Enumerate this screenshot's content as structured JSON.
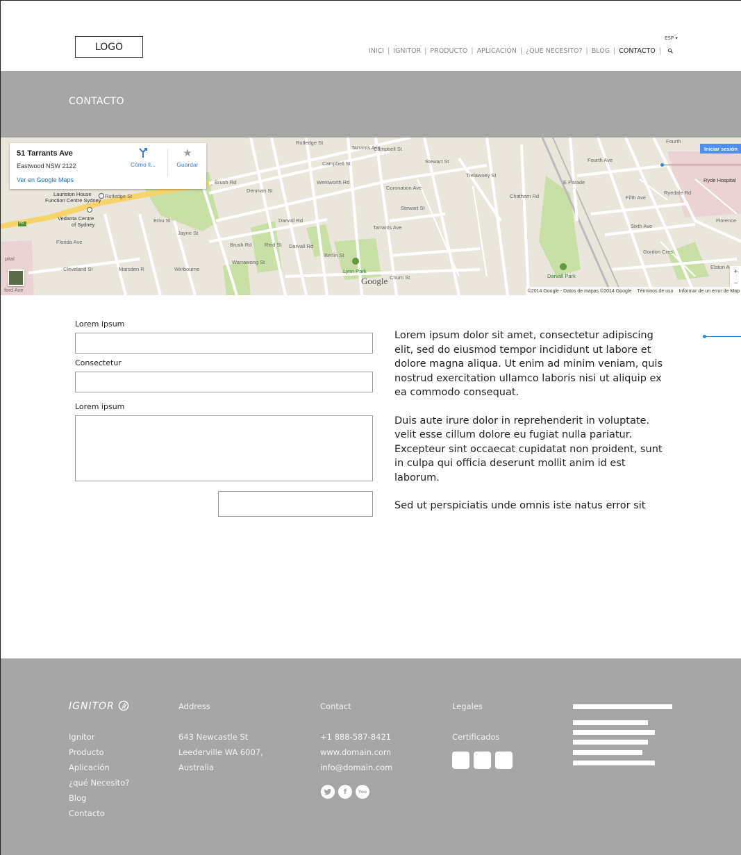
{
  "header": {
    "logo": "LOGO",
    "language": "ESP ▾",
    "nav": [
      {
        "label": "INICI",
        "active": false
      },
      {
        "label": "IGNITOR",
        "active": false
      },
      {
        "label": "PRODUCTO",
        "active": false
      },
      {
        "label": "APLICACIÓN",
        "active": false
      },
      {
        "label": "¿QUÉ NECESITO?",
        "active": false
      },
      {
        "label": "BLOG",
        "active": false
      },
      {
        "label": "CONTACTO",
        "active": true
      }
    ],
    "search_icon": "search-icon"
  },
  "banner": {
    "title": "CONTACTO"
  },
  "map": {
    "card": {
      "name": "51 Tarrants Ave",
      "address": "Eastwood NSW 2122",
      "link": "Ver en Google Maps",
      "directions": "Cómo ll...",
      "save": "Guardar"
    },
    "signin": "Iniciar sesión",
    "zoom_in": "+",
    "zoom_out": "−",
    "google": "Google",
    "attribution": [
      "©2014 Google - Datos de mapas ©2014 Google",
      "Términos de uso",
      "Informar de un error de Map"
    ],
    "labels": {
      "rutledge": "Rutledge St",
      "rutledge2": "Rutledge St",
      "campbell": "Campbell St",
      "campbell2": "Campbell St",
      "tarrants_top": "Tarrants Ave",
      "tarrants": "Tarrants Ave",
      "wentworth": "Wentworth Rd",
      "stewart": "Stewart St",
      "stewart2": "Stewart St",
      "coronation": "Coronation Ave",
      "trelawney": "Trelawney St",
      "chatham": "Chatham Rd",
      "eparade": "E Parade",
      "ryedale": "Ryedale Rd",
      "fourth": "Fourth Ave",
      "fifth": "Fifth Ave",
      "sixth": "Sixth Ave",
      "florence": "Florence",
      "gordon": "Gordon Cres",
      "elston": "Elston Ave",
      "ryde_hospital": "Ryde Hospital",
      "lauriston": "Lauriston House",
      "lauriston2": "Function Centre Sydney",
      "vedanta": "Vedanta Centre",
      "vedanta2": "of Sydney",
      "florida": "Florida Ave",
      "cleveland": "Cleveland St",
      "emu": "Emu St",
      "jayne": "Jayne St",
      "brush": "Brush Rd",
      "brush2": "Brush Rd",
      "denman": "Denman St",
      "darvall": "Darvall Rd",
      "darvall2": "Darvall Rd",
      "reid": "Reid St",
      "warrawong": "Warrawong St",
      "berlin": "Berlin St",
      "lynn_park": "Lynn Park",
      "darvall_park": "Darvall Park",
      "marsden": "Marsden R",
      "winbourne": "Winbourne",
      "a6": "A6",
      "pital": "pital",
      "ford": "ford Ave",
      "chum": "Chum St",
      "fourth_top": "Fourth"
    }
  },
  "form": {
    "label1": "Lorem ipsum",
    "label2": "Consectetur",
    "label3": "Lorem ipsum"
  },
  "content": {
    "p1": "Lorem ipsum dolor sit amet, consectetur adipiscing elit, sed do eiusmod tempor incididunt ut labore et dolore magna aliqua. Ut enim ad minim veniam, quis nostrud exercitation ullamco laboris nisi ut aliquip ex ea commodo consequat.",
    "p2": "Duis aute irure dolor in reprehenderit in voluptate.  velit esse cillum dolore eu fugiat nulla pariatur. Excepteur sint occaecat cupidatat non proident, sunt in culpa qui officia deserunt mollit anim id est laborum.",
    "p3": "Sed ut perspiciatis unde omnis iste natus error sit"
  },
  "footer": {
    "brand": "IGNITOR",
    "nav_links": [
      "Ignitor",
      "Producto",
      "Aplicación",
      "¿qué Necesito?",
      "Blog",
      "Contacto"
    ],
    "address_head": "Address",
    "address_lines": [
      "643 Newcastle St",
      "Leederville WA 6007,",
      "Australia"
    ],
    "contact_head": "Contact",
    "contact_lines": [
      "+1 888-587-8421",
      "www.domain.com",
      "info@domain.com"
    ],
    "social": [
      "twitter-icon",
      "facebook-icon",
      "youtube-icon"
    ],
    "legal_head": "Legales",
    "cert_label": "Certificados"
  },
  "colors": {
    "banner": "#a6a6a6",
    "accent": "#3a83e0",
    "map_road": "#ffffff",
    "map_park": "#c8dfa5"
  }
}
